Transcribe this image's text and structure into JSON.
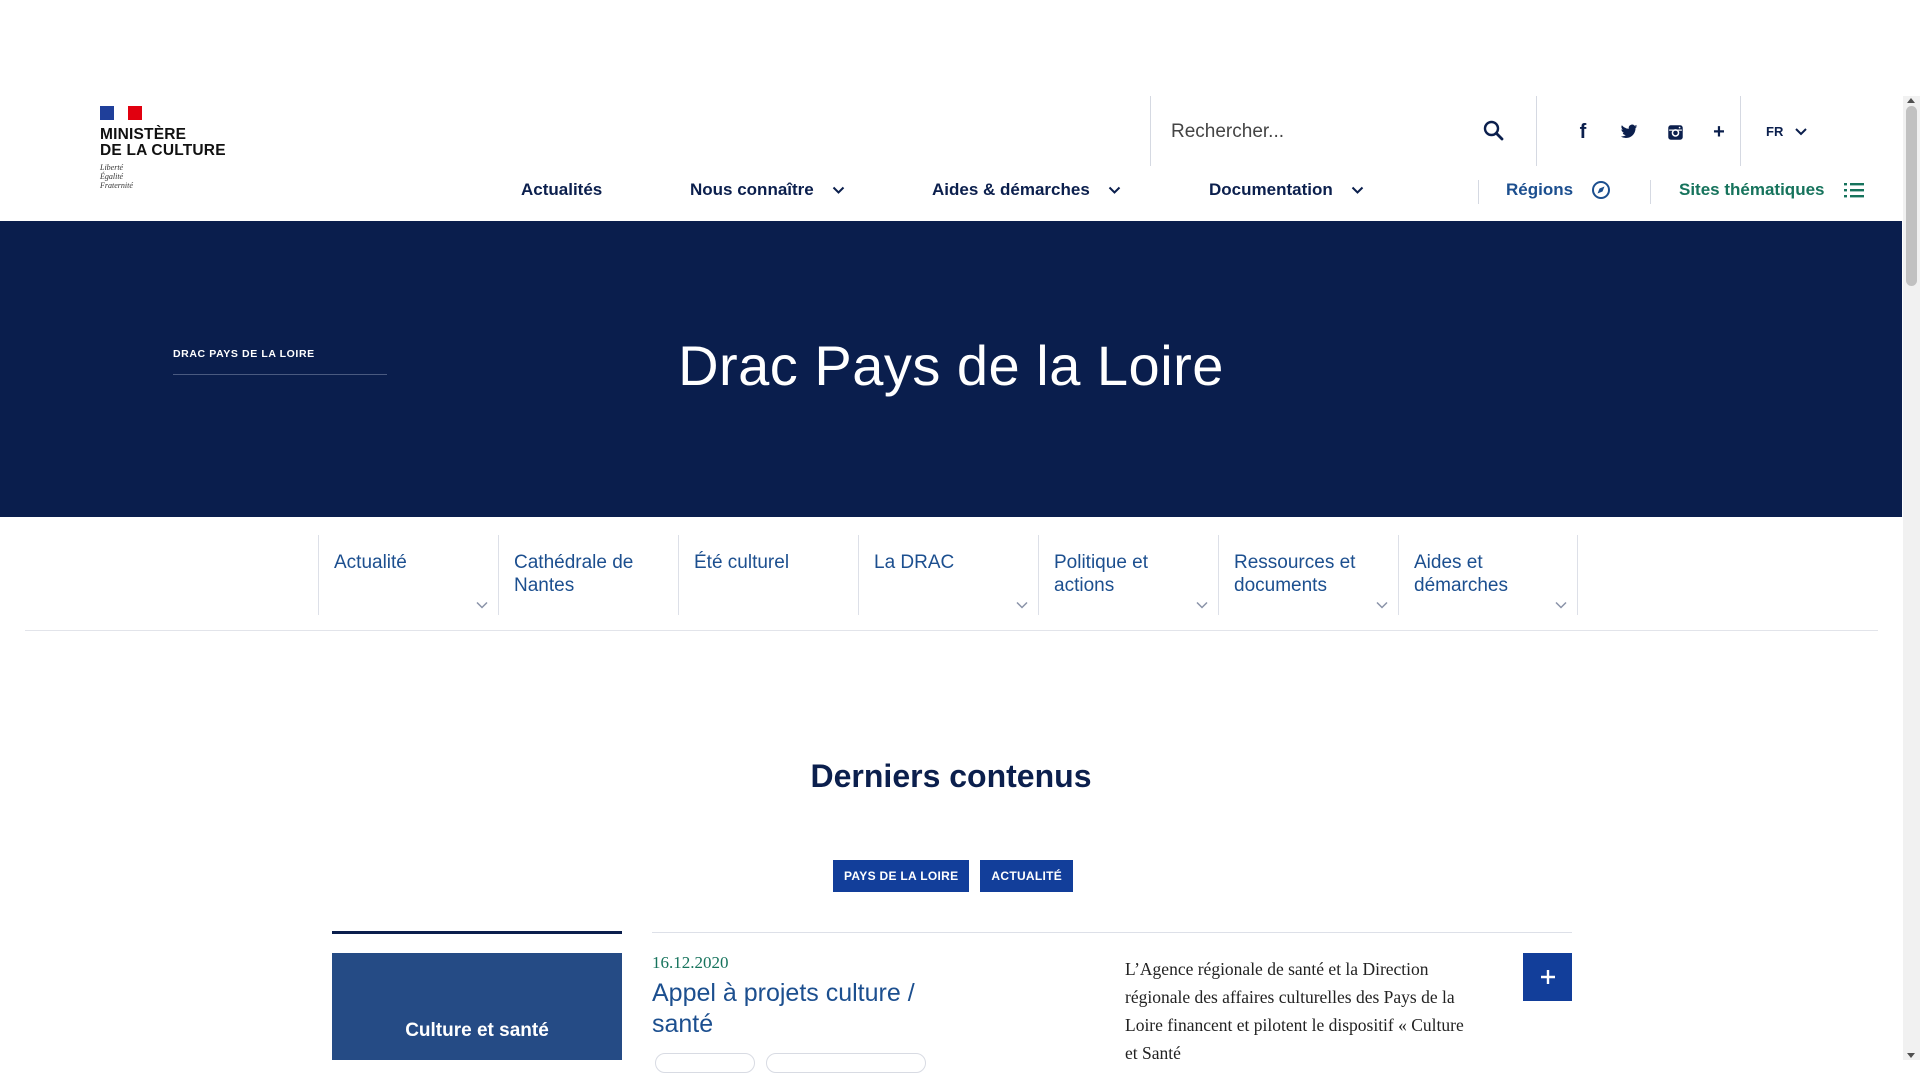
{
  "header": {
    "logo": {
      "name_line1": "MINISTÈRE",
      "name_line2": "DE LA CULTURE",
      "motto_1": "Liberté",
      "motto_2": "Égalité",
      "motto_3": "Fraternité"
    },
    "search_placeholder": "Rechercher...",
    "social": [
      {
        "icon": "facebook-icon",
        "glyph": "f"
      },
      {
        "icon": "twitter-icon"
      },
      {
        "icon": "instagram-icon"
      },
      {
        "icon": "plus-icon",
        "glyph": "+"
      }
    ],
    "lang": "FR",
    "nav": {
      "actualites": "Actualités",
      "nous_connaitre": "Nous connaître",
      "aides": "Aides & démarches",
      "documentation": "Documentation",
      "regions": "Régions",
      "sites": "Sites thématiques"
    }
  },
  "hero": {
    "breadcrumb": "DRAC PAYS DE LA LOIRE",
    "title": "Drac Pays de la Loire"
  },
  "subnav": {
    "tabs": [
      {
        "label": "Actualité",
        "has_dropdown": true
      },
      {
        "label": "Cathédrale de Nantes",
        "has_dropdown": false
      },
      {
        "label": "Été culturel",
        "has_dropdown": false
      },
      {
        "label": "La DRAC",
        "has_dropdown": true
      },
      {
        "label": "Politique et actions",
        "has_dropdown": true
      },
      {
        "label": "Ressources et documents",
        "has_dropdown": true
      },
      {
        "label": "Aides et démarches",
        "has_dropdown": true
      }
    ]
  },
  "latest": {
    "title": "Derniers contenus",
    "tags": [
      "PAYS DE LA LOIRE",
      "ACTUALITÉ"
    ],
    "card": {
      "thumb_label": "Culture et santé",
      "date": "16.12.2020",
      "title": "Appel à projets culture / santé",
      "description": "L’Agence régionale de santé et la Direction régionale des affaires culturelles des Pays de la Loire financent et pilotent le dispositif « Culture et Santé"
    }
  },
  "colors": {
    "navy": "#0a1e4d",
    "blue": "#123e9a",
    "link": "#1c4f8f",
    "green": "#16735c",
    "flag_red": "#e1000f"
  }
}
